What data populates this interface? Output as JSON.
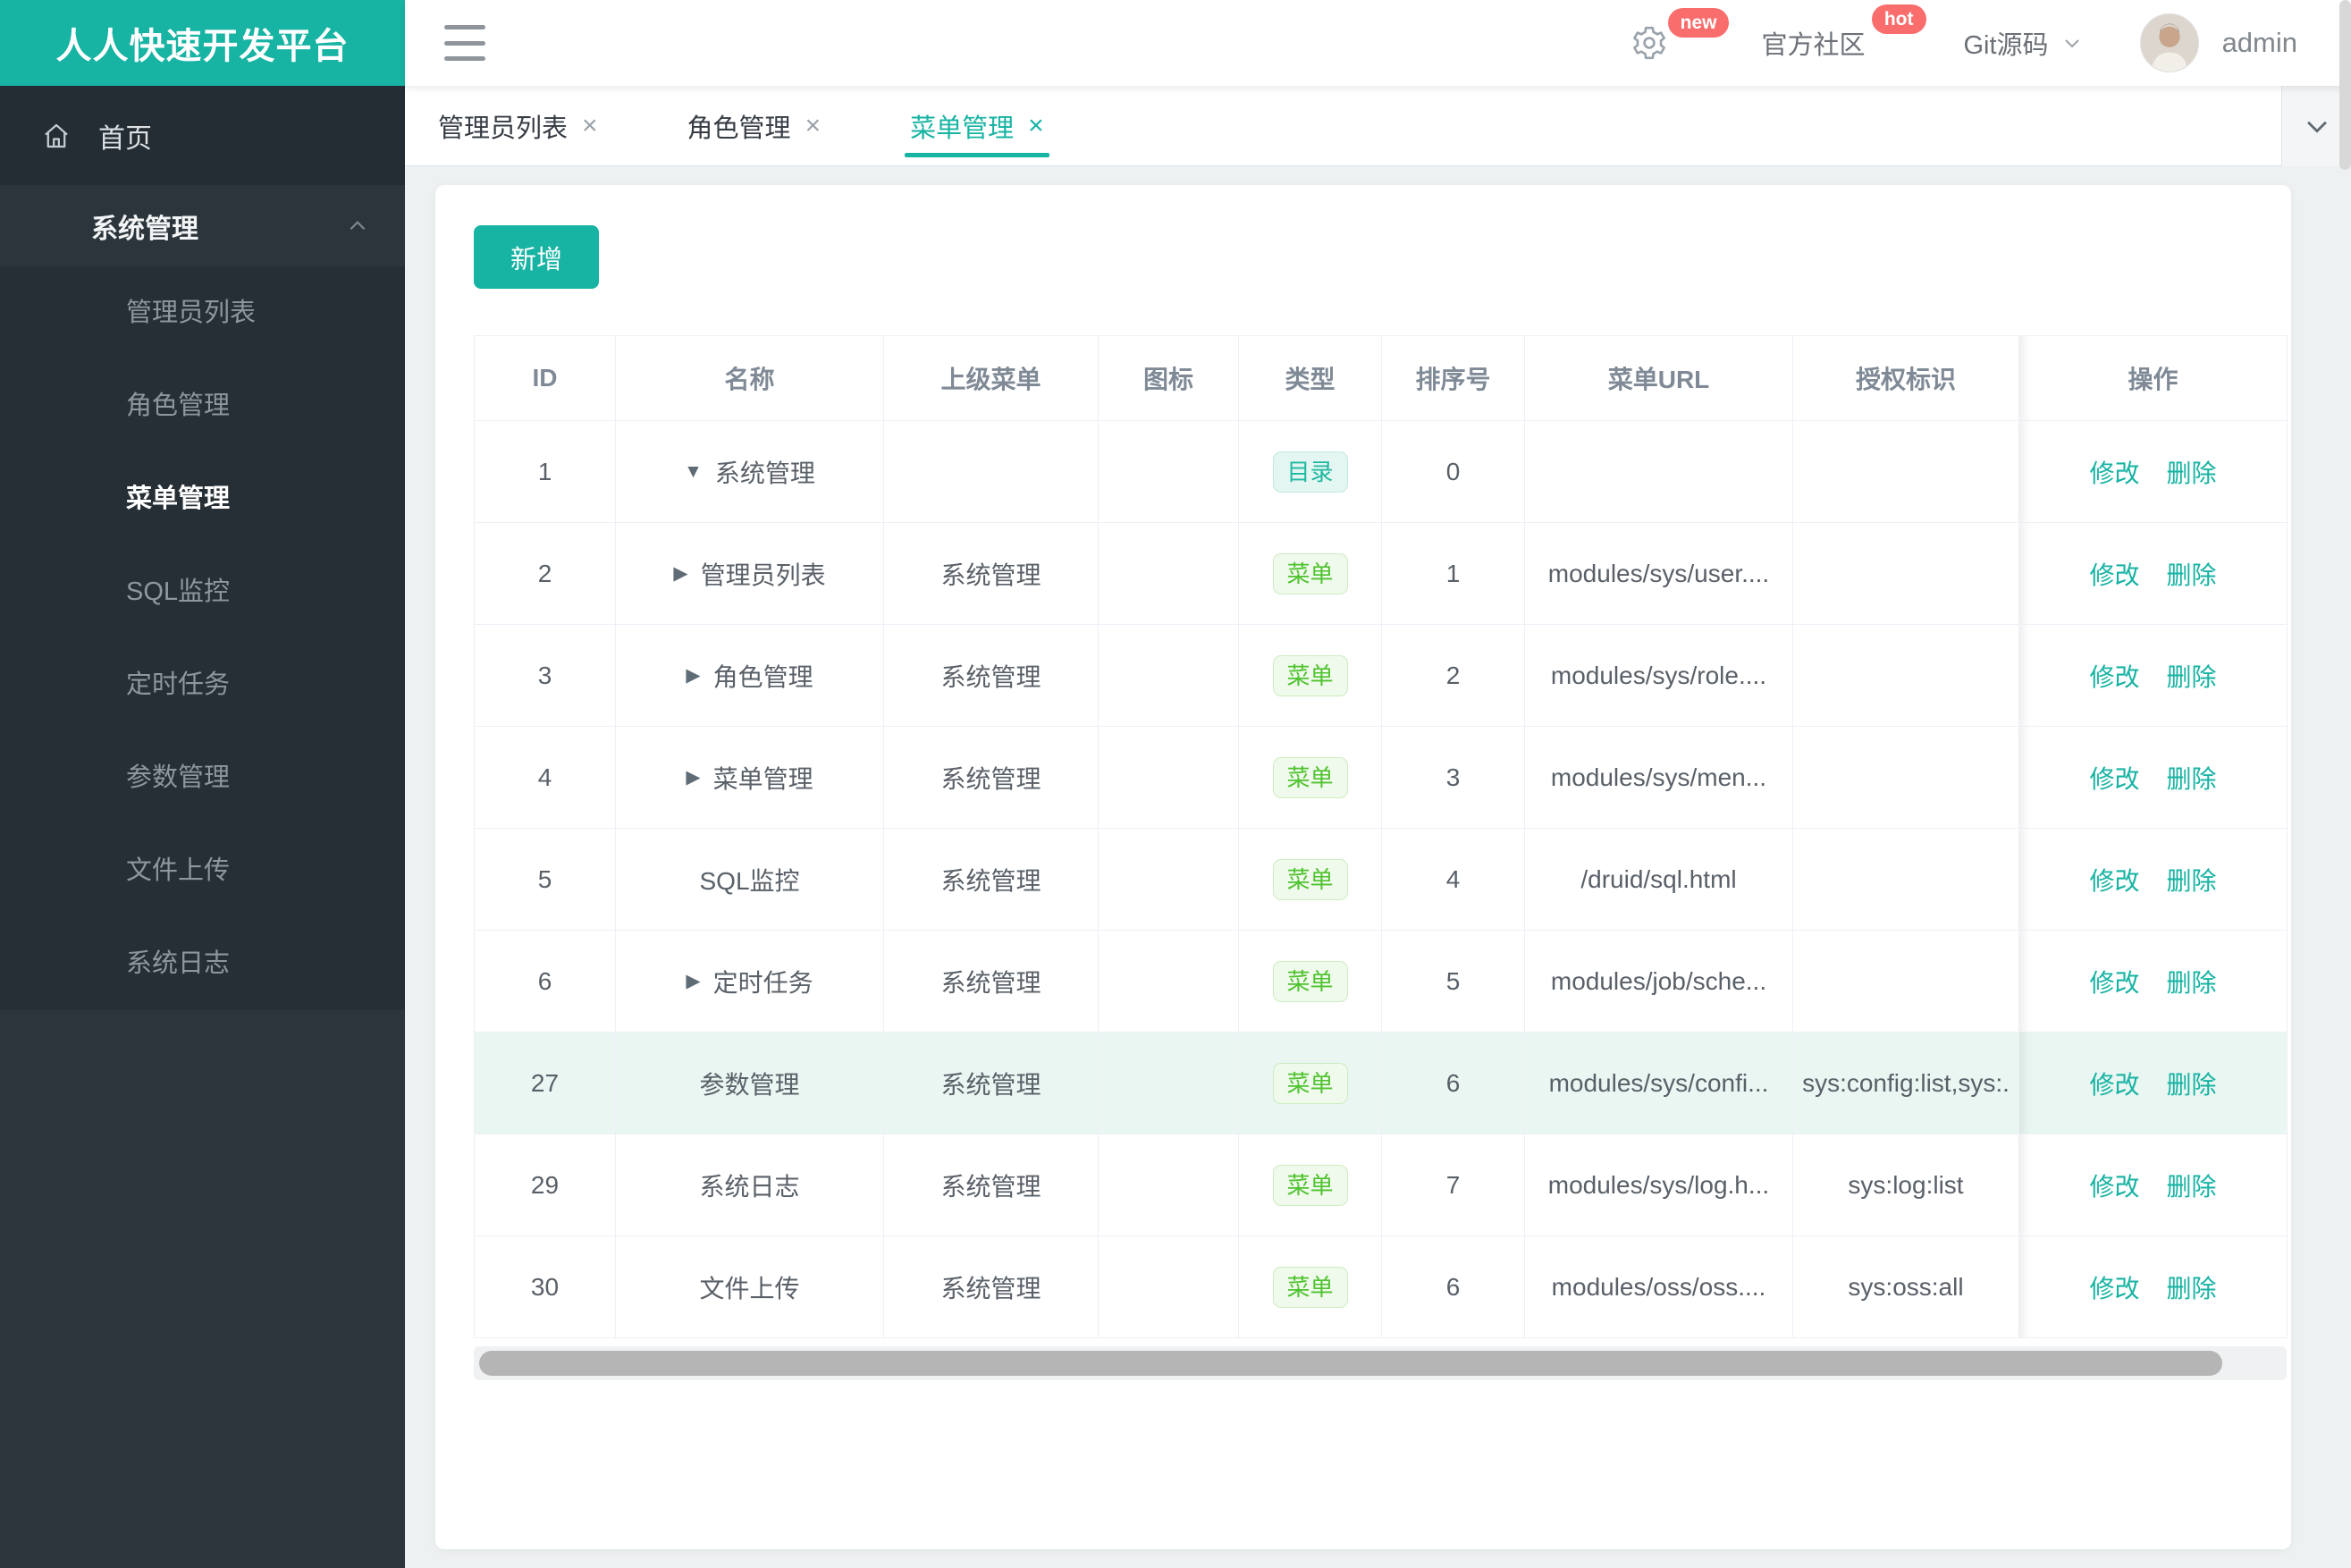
{
  "brand": {
    "title": "人人快速开发平台",
    "color": "#17b3a3"
  },
  "header": {
    "settings_badge": "new",
    "community_label": "官方社区",
    "community_badge": "hot",
    "git_label": "Git源码",
    "user_name": "admin"
  },
  "sidebar": {
    "home_label": "首页",
    "group_label": "系统管理",
    "items": [
      {
        "key": "admin-list",
        "label": "管理员列表",
        "active": false
      },
      {
        "key": "role-mgmt",
        "label": "角色管理",
        "active": false
      },
      {
        "key": "menu-mgmt",
        "label": "菜单管理",
        "active": true
      },
      {
        "key": "sql-monitor",
        "label": "SQL监控",
        "active": false
      },
      {
        "key": "scheduled-tasks",
        "label": "定时任务",
        "active": false
      },
      {
        "key": "param-mgmt",
        "label": "参数管理",
        "active": false
      },
      {
        "key": "file-upload",
        "label": "文件上传",
        "active": false
      },
      {
        "key": "system-log",
        "label": "系统日志",
        "active": false
      }
    ]
  },
  "tabs": {
    "close_glyph": "×",
    "list": [
      {
        "key": "admin-list",
        "label": "管理员列表",
        "active": false
      },
      {
        "key": "role-mgmt",
        "label": "角色管理",
        "active": false
      },
      {
        "key": "menu-mgmt",
        "label": "菜单管理",
        "active": true
      }
    ]
  },
  "toolbar": {
    "add_label": "新增"
  },
  "table": {
    "columns": [
      "ID",
      "名称",
      "上级菜单",
      "图标",
      "类型",
      "排序号",
      "菜单URL",
      "授权标识",
      "操作"
    ],
    "type_labels": {
      "dir": "目录",
      "menu": "菜单"
    },
    "actions": {
      "edit": "修改",
      "delete": "删除"
    },
    "rows": [
      {
        "id": "1",
        "arrow": "down",
        "name": "系统管理",
        "parent": "",
        "icon": "",
        "type": "dir",
        "sort": "0",
        "url": "",
        "perms": "",
        "highlight": false
      },
      {
        "id": "2",
        "arrow": "right",
        "name": "管理员列表",
        "parent": "系统管理",
        "icon": "",
        "type": "menu",
        "sort": "1",
        "url": "modules/sys/user....",
        "perms": "",
        "highlight": false
      },
      {
        "id": "3",
        "arrow": "right",
        "name": "角色管理",
        "parent": "系统管理",
        "icon": "",
        "type": "menu",
        "sort": "2",
        "url": "modules/sys/role....",
        "perms": "",
        "highlight": false
      },
      {
        "id": "4",
        "arrow": "right",
        "name": "菜单管理",
        "parent": "系统管理",
        "icon": "",
        "type": "menu",
        "sort": "3",
        "url": "modules/sys/men...",
        "perms": "",
        "highlight": false
      },
      {
        "id": "5",
        "arrow": "",
        "name": "SQL监控",
        "parent": "系统管理",
        "icon": "",
        "type": "menu",
        "sort": "4",
        "url": "/druid/sql.html",
        "perms": "",
        "highlight": false
      },
      {
        "id": "6",
        "arrow": "right",
        "name": "定时任务",
        "parent": "系统管理",
        "icon": "",
        "type": "menu",
        "sort": "5",
        "url": "modules/job/sche...",
        "perms": "",
        "highlight": false
      },
      {
        "id": "27",
        "arrow": "",
        "name": "参数管理",
        "parent": "系统管理",
        "icon": "",
        "type": "menu",
        "sort": "6",
        "url": "modules/sys/confi...",
        "perms": "sys:config:list,sys:.",
        "highlight": true
      },
      {
        "id": "29",
        "arrow": "",
        "name": "系统日志",
        "parent": "系统管理",
        "icon": "",
        "type": "menu",
        "sort": "7",
        "url": "modules/sys/log.h...",
        "perms": "sys:log:list",
        "highlight": false
      },
      {
        "id": "30",
        "arrow": "",
        "name": "文件上传",
        "parent": "系统管理",
        "icon": "",
        "type": "menu",
        "sort": "6",
        "url": "modules/oss/oss....",
        "perms": "sys:oss:all",
        "highlight": false
      }
    ]
  }
}
